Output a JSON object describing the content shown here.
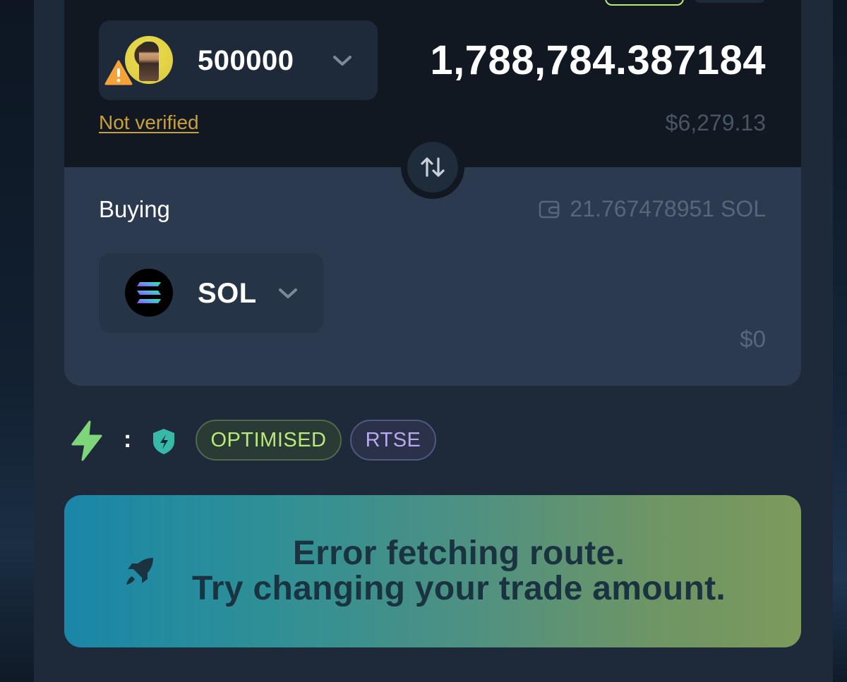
{
  "selling": {
    "token_symbol": "500000",
    "amount": "1,788,784.387184",
    "verification_status": "Not verified",
    "usd_value": "$6,279.13"
  },
  "buying": {
    "label": "Buying",
    "wallet_balance": "21.767478951 SOL",
    "token_symbol": "SOL",
    "usd_value": "$0"
  },
  "route_options": {
    "mode_tag": "OPTIMISED",
    "engine_tag": "RTSE",
    "separator": ":"
  },
  "error": {
    "line1": "Error fetching route.",
    "line2": "Try changing your trade amount."
  },
  "icons": {
    "warning": "warning-icon",
    "chevron": "chevron-down-icon",
    "swap": "swap-arrows-icon",
    "wallet": "wallet-icon",
    "bolt": "lightning-bolt-icon",
    "shield": "shield-icon",
    "rocket": "rocket-icon",
    "solana": "solana-logo-icon"
  },
  "colors": {
    "accent_green": "#b9e97a",
    "accent_purple": "#b8a8f0",
    "warning_yellow": "#c9a13a",
    "banner_start": "#1a86a8",
    "banner_end": "#7c9a5c"
  }
}
